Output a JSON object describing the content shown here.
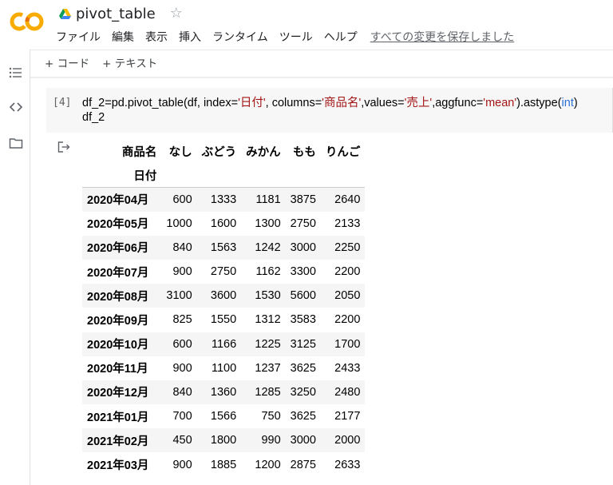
{
  "app": {
    "logo_text": "CO",
    "title": "pivot_table",
    "star_icon": "star-outline-icon",
    "brand_colors": {
      "logo_orange": "#f9ab00",
      "logo_dark_orange": "#e8710a"
    }
  },
  "menu": {
    "items": [
      {
        "label": "ファイル"
      },
      {
        "label": "編集"
      },
      {
        "label": "表示"
      },
      {
        "label": "挿入"
      },
      {
        "label": "ランタイム"
      },
      {
        "label": "ツール"
      },
      {
        "label": "ヘルプ"
      }
    ],
    "save_status": "すべての変更を保存しました"
  },
  "sidebar": {
    "icons": [
      "table-of-contents-icon",
      "code-snippets-icon",
      "folder-icon"
    ]
  },
  "toolbar": {
    "add_code": "+ コード",
    "add_text": "+ テキスト"
  },
  "cell": {
    "exec_count": "[4]",
    "code_line1": {
      "p1": "df_2=pd.pivot_table(df, index=",
      "s1": "'日付'",
      "p2": ", columns=",
      "s2": "'商品名'",
      "p3": ",values=",
      "s3": "'売上'",
      "p4": ",aggfunc=",
      "s4": "'mean'",
      "p5": ").astype(",
      "k1": "int",
      "p6": ")"
    },
    "code_line2": "df_2",
    "output_icon": "output-arrow-icon"
  },
  "table": {
    "columns_name": "商品名",
    "index_name": "日付",
    "columns": [
      "なし",
      "ぶどう",
      "みかん",
      "もも",
      "りんご"
    ],
    "rows": [
      {
        "label": "2020年04月",
        "values": [
          "600",
          "1333",
          "1181",
          "3875",
          "2640"
        ]
      },
      {
        "label": "2020年05月",
        "values": [
          "1000",
          "1600",
          "1300",
          "2750",
          "2133"
        ]
      },
      {
        "label": "2020年06月",
        "values": [
          "840",
          "1563",
          "1242",
          "3000",
          "2250"
        ]
      },
      {
        "label": "2020年07月",
        "values": [
          "900",
          "2750",
          "1162",
          "3300",
          "2200"
        ]
      },
      {
        "label": "2020年08月",
        "values": [
          "3100",
          "3600",
          "1530",
          "5600",
          "2050"
        ]
      },
      {
        "label": "2020年09月",
        "values": [
          "825",
          "1550",
          "1312",
          "3583",
          "2200"
        ]
      },
      {
        "label": "2020年10月",
        "values": [
          "600",
          "1166",
          "1225",
          "3125",
          "1700"
        ]
      },
      {
        "label": "2020年11月",
        "values": [
          "900",
          "1100",
          "1237",
          "3625",
          "2433"
        ]
      },
      {
        "label": "2020年12月",
        "values": [
          "840",
          "1360",
          "1285",
          "3250",
          "2480"
        ]
      },
      {
        "label": "2021年01月",
        "values": [
          "700",
          "1566",
          "750",
          "3625",
          "2177"
        ]
      },
      {
        "label": "2021年02月",
        "values": [
          "450",
          "1800",
          "990",
          "3000",
          "2000"
        ]
      },
      {
        "label": "2021年03月",
        "values": [
          "900",
          "1885",
          "1200",
          "2875",
          "2633"
        ]
      }
    ]
  }
}
